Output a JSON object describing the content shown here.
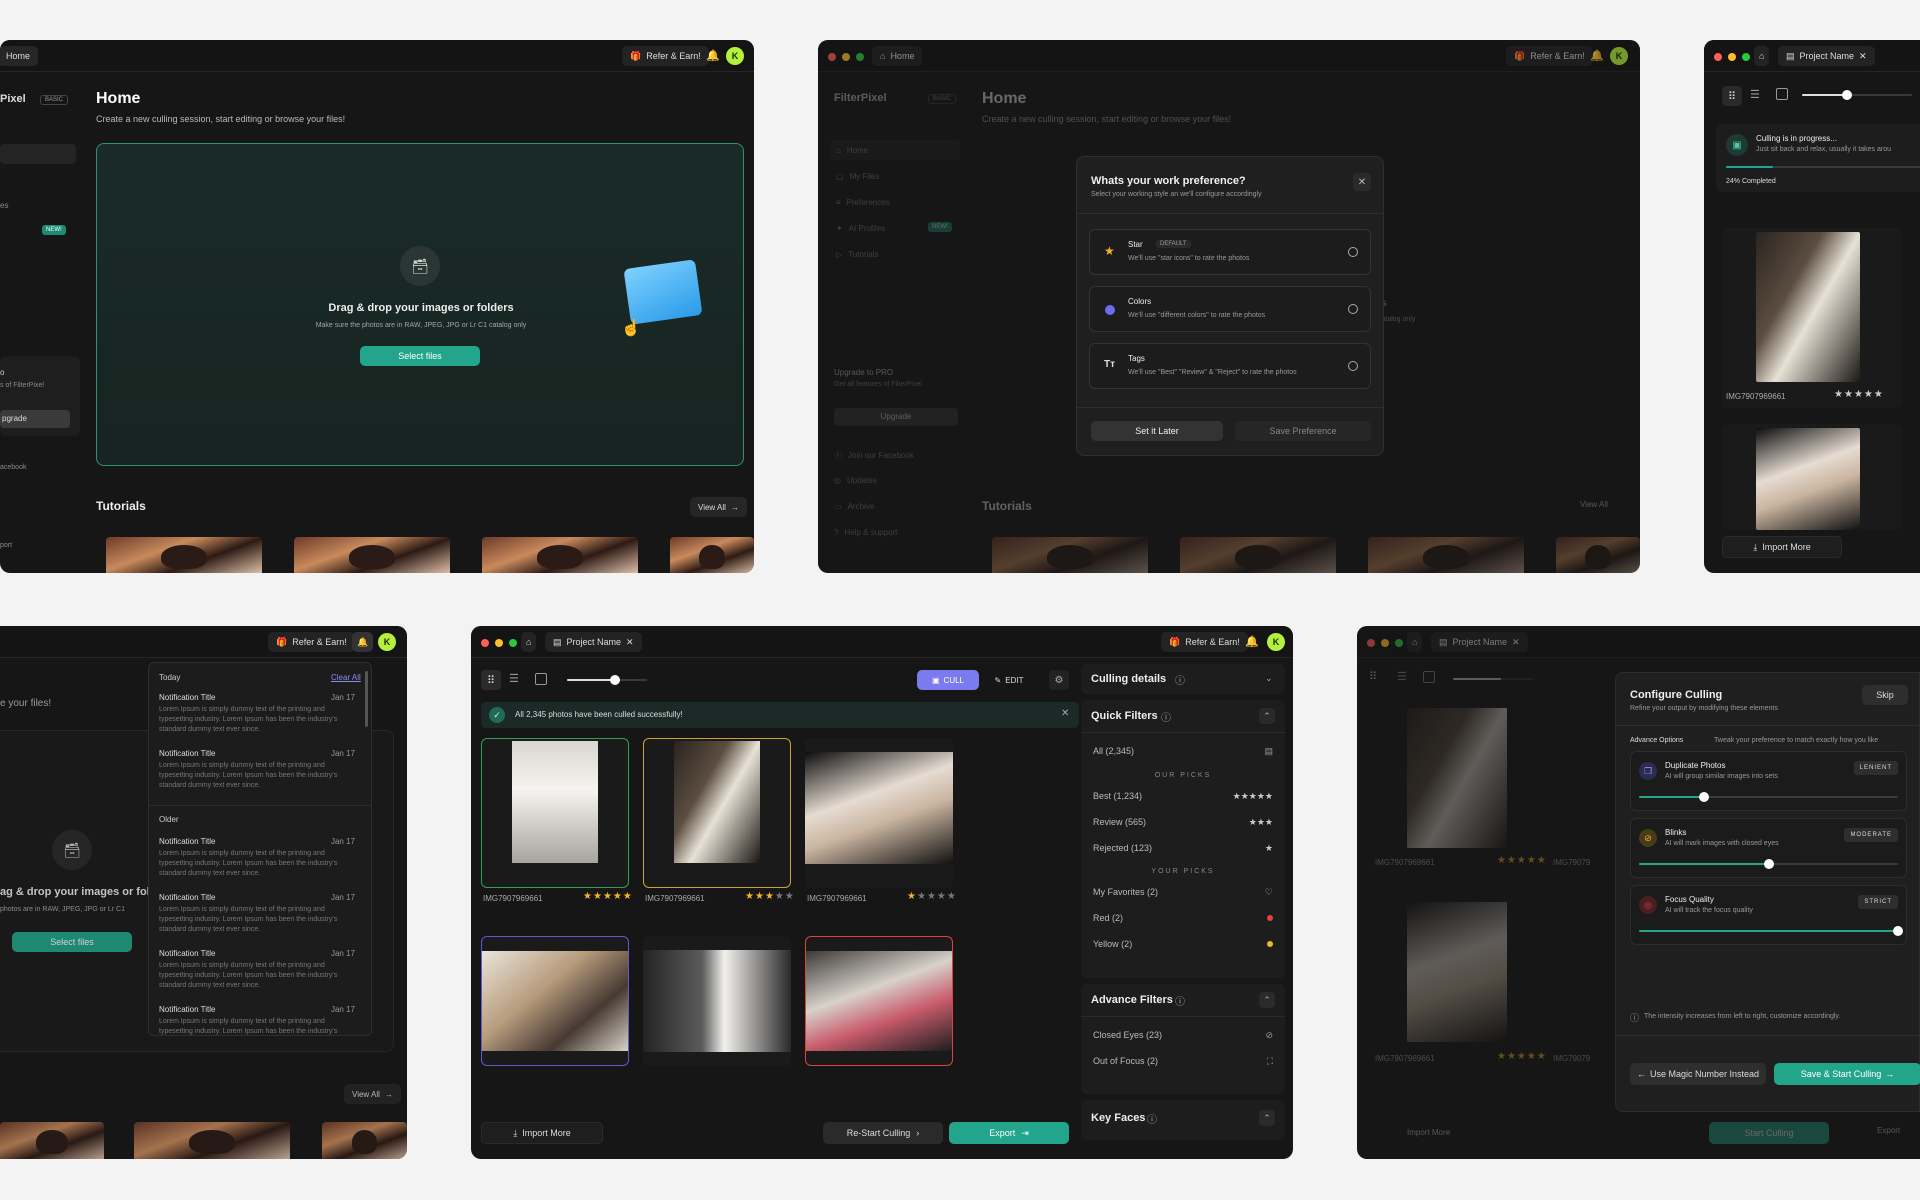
{
  "common": {
    "home_tab": "Home",
    "refer": "Refer & Earn!",
    "avatar_letter": "K",
    "project_tab": "Project Name",
    "import_more": "Import More"
  },
  "home": {
    "title": "Home",
    "subtitle": "Create a new culling session, start editing or browse your files!",
    "drop_title": "Drag & drop your images or folders",
    "drop_hint": "Make sure the photos are in RAW, JPEG, JPG or Lr C1 catalog only",
    "select_files": "Select files",
    "tutorials": "Tutorials",
    "view_all": "View All",
    "sidebar_brand_partial": "Pixel",
    "basic_badge": "BASIC",
    "new_badge": "NEW!",
    "upgrade_partial_1": "o",
    "upgrade_partial_2": "s of FilterPixel",
    "upgrade_btn_partial": "pgrade",
    "facebook_partial": "acebook",
    "support_partial": "port",
    "files_partial": "es"
  },
  "pref": {
    "brand": "FilterPixel",
    "basic_badge": "BASIC",
    "sidebar": [
      "Home",
      "My Files",
      "Preferences",
      "AI Profiles",
      "Tutorials"
    ],
    "new_badge": "NEW!",
    "upgrade_title": "Upgrade to PRO",
    "upgrade_sub": "Get all features of FilterPixel",
    "upgrade_btn": "Upgrade",
    "bottom_links": [
      "Join our Facebook",
      "Updates",
      "Archive",
      "Help & support"
    ],
    "modal_title": "Whats your work preference?",
    "modal_sub": "Select your working style an we'll configure accordingly",
    "options": [
      {
        "name": "Star",
        "badge": "DEFAULT",
        "desc": "We'll use \"star icons\" to rate the photos"
      },
      {
        "name": "Colors",
        "badge": "",
        "desc": "We'll use \"different colors\" to rate the photos"
      },
      {
        "name": "Tags",
        "badge": "",
        "desc": "We'll use \"Best\" \"Review\" & \"Reject\" to rate the photos"
      }
    ],
    "set_later": "Set it Later",
    "save_pref": "Save Preference",
    "bg_frag_1": "rs",
    "bg_frag_2": "catalog only",
    "home_title": "Home",
    "home_sub": "Create a new culling session, start editing or browse your files!",
    "tutorials": "Tutorials",
    "view_all": "View All"
  },
  "progress": {
    "title": "Culling is in progress...",
    "sub": "Just sit back and relax, usually it takes arou",
    "percent_label": "24% Completed",
    "percent": 24,
    "image_name": "IMG7907969661",
    "rating": 5
  },
  "notifications": {
    "today": "Today",
    "clear_all": "Clear All",
    "older": "Older",
    "title": "Notification Title",
    "date": "Jan 17",
    "body": "Lorem Ipsum is simply dummy text of the printing and typesetting industry. Lorem Ipsum has been the industry's standard dummy text ever since.",
    "bg_sub_partial": "e your files!",
    "bg_drop_partial": "ag & drop your images or folde",
    "bg_hint_partial": "photos are in RAW, JPEG, JPG or Lr C1",
    "select_files": "Select files",
    "view_all": "View All"
  },
  "cull": {
    "cull_btn": "CULL",
    "edit_btn": "EDIT",
    "success": "All 2,345 photos have been culled successfully!",
    "photos": [
      {
        "name": "IMG7907969661",
        "rating": 5,
        "border": "#2f9e55"
      },
      {
        "name": "IMG7907969661",
        "rating": 3,
        "border": "#c9a230"
      },
      {
        "name": "IMG7907969661",
        "rating": 1,
        "border": "none"
      },
      {
        "name": "",
        "rating": 0,
        "border": "#5b5bd6"
      },
      {
        "name": "",
        "rating": 0,
        "border": "none"
      },
      {
        "name": "",
        "rating": 0,
        "border": "#d9453d"
      }
    ],
    "restart": "Re-Start Culling",
    "export": "Export",
    "culling_details": "Culling details",
    "quick_filters": "Quick Filters",
    "all": "All (2,345)",
    "our_picks": "OUR PICKS",
    "best": "Best (1,234)",
    "review": "Review (565)",
    "rejected": "Rejected (123)",
    "your_picks": "YOUR PICKS",
    "favorites": "My Favorites (2)",
    "red": "Red (2)",
    "yellow": "Yellow (2)",
    "advance_filters": "Advance Filters",
    "closed_eyes": "Closed Eyes (23)",
    "out_of_focus": "Out of Focus (2)",
    "key_faces": "Key Faces",
    "colors": {
      "red": "#e2443c",
      "yellow": "#f3b429",
      "accent": "#7b7bf0",
      "teal": "#22a58a"
    }
  },
  "configure": {
    "title": "Configure Culling",
    "sub": "Refine your output by modifying these elements",
    "skip": "Skip",
    "advance": "Advance Options",
    "tweak": "Tweak your preference to match exactly how you like",
    "items": [
      {
        "name": "Duplicate Photos",
        "desc": "AI will group similar images into sets",
        "tag": "LENIENT",
        "level": 0.25
      },
      {
        "name": "Blinks",
        "desc": "AI will mark images with closed eyes",
        "tag": "MODERATE",
        "level": 0.5
      },
      {
        "name": "Focus Quality",
        "desc": "AI will track the focus quality",
        "tag": "STRICT",
        "level": 1.0
      }
    ],
    "note": "The intensity increases from left to right, customize accordingly.",
    "magic": "Use Magic Number Instead",
    "save_start": "Save & Start Culling",
    "bg_img_name": "IMG7907969661",
    "bg_img_partial": "IMG79079",
    "bg_start": "Start Culling",
    "bg_export": "Export",
    "bg_import": "Import More"
  }
}
